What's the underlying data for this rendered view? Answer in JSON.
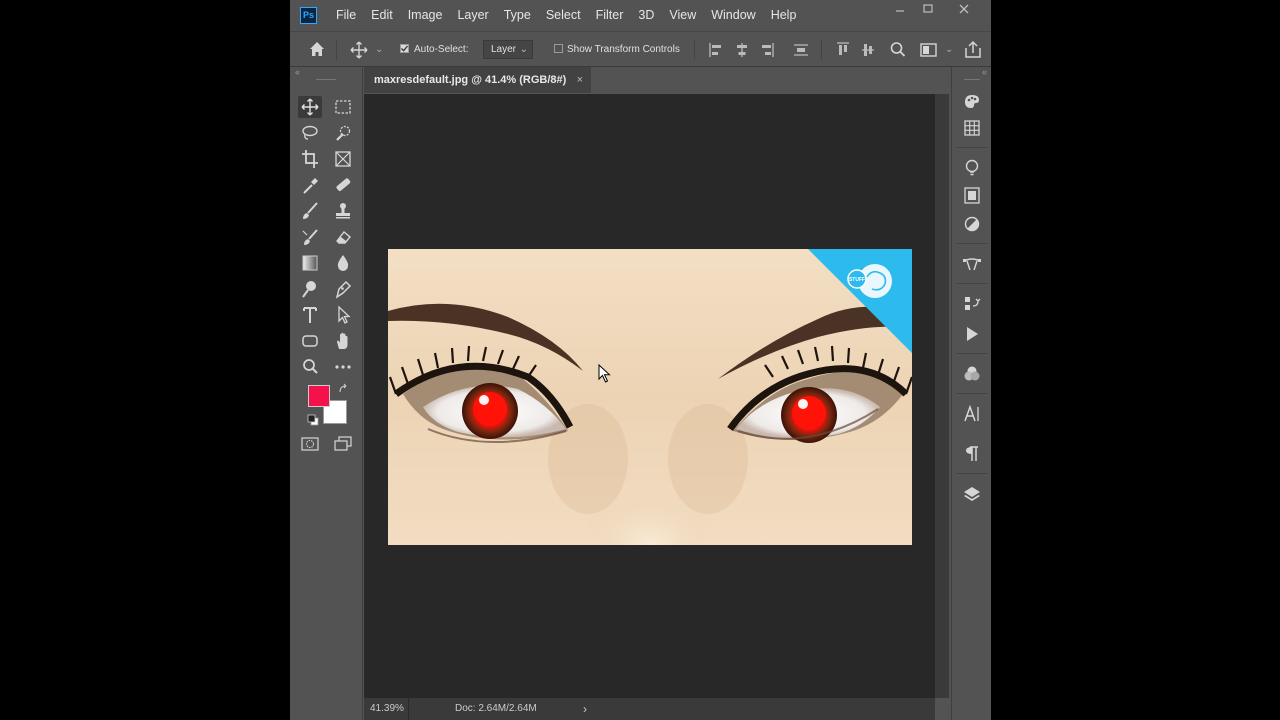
{
  "app": {
    "logo_text": "Ps",
    "menu": [
      "File",
      "Edit",
      "Image",
      "Layer",
      "Type",
      "Select",
      "Filter",
      "3D",
      "View",
      "Window",
      "Help"
    ],
    "window_controls": [
      "minimize-icon",
      "maximize-icon",
      "close-icon"
    ]
  },
  "options_bar": {
    "auto_select_label": "Auto-Select:",
    "auto_select_checked": true,
    "auto_select_value": "Layer",
    "show_transform_label": "Show Transform Controls",
    "show_transform_checked": false,
    "chevron": "⌄"
  },
  "toolbar": {
    "collapse_glyph": "«",
    "tools": [
      "move-icon",
      "marquee-icon",
      "lasso-icon",
      "quick-selection-icon",
      "crop-icon",
      "frame-icon",
      "eyedropper-icon",
      "healing-brush-icon",
      "brush-icon",
      "clone-stamp-icon",
      "history-brush-icon",
      "eraser-icon",
      "gradient-icon",
      "blur-icon",
      "dodge-icon",
      "pen-icon",
      "type-icon",
      "path-selection-icon",
      "rectangle-icon",
      "hand-icon",
      "zoom-icon",
      "more-tools-icon"
    ],
    "foreground_color": "#f5114a",
    "background_color": "#ffffff"
  },
  "document": {
    "tab_title": "maxresdefault.jpg @ 41.4% (RGB/8#)",
    "close_glyph": "×",
    "photo_subject": "eyes with red-eye effect",
    "badge_text": "STUFF"
  },
  "right_panel": {
    "collapse_glyph": "«",
    "icons": [
      "color-icon",
      "swatches-icon",
      "learn-icon",
      "libraries-icon",
      "adjustments-icon",
      "paths-icon",
      "history-icon",
      "actions-icon",
      "channels-icon",
      "character-icon",
      "paragraph-icon",
      "layers-icon"
    ]
  },
  "status_bar": {
    "zoom": "41.39%",
    "doc_size": "Doc: 2.64M/2.64M",
    "arrow": "›"
  }
}
